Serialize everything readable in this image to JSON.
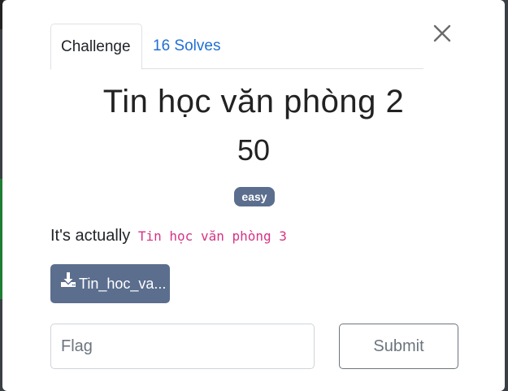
{
  "modal": {
    "close_icon": "close-icon",
    "tabs": [
      {
        "label": "Challenge",
        "active": true
      },
      {
        "label": "16 Solves",
        "active": false
      }
    ],
    "challenge": {
      "name": "Tin học văn phòng 2",
      "points": "50",
      "tag": "easy",
      "description_text": "It's actually",
      "description_code": "Tin học văn phòng 3",
      "file_label": "Tin_hoc_va...",
      "file_icon": "download-icon"
    },
    "flag": {
      "placeholder": "Flag",
      "value": ""
    },
    "submit_label": "Submit"
  },
  "colors": {
    "tab_link": "#1f6fd6",
    "badge_bg": "#5b6e8e",
    "file_button_bg": "#5b6e8e",
    "code_text": "#d63384",
    "submit_border": "#6c757d"
  }
}
